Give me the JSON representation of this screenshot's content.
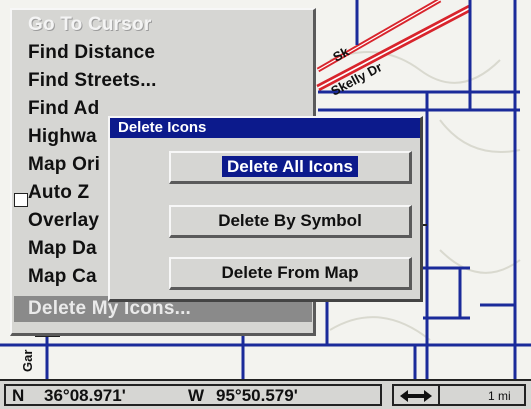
{
  "menu": {
    "items": [
      {
        "label": "Go To Cursor",
        "state": "disabled"
      },
      {
        "label": "Find Distance",
        "state": "normal"
      },
      {
        "label": "Find Streets...",
        "state": "normal"
      },
      {
        "label": "Find Ad",
        "state": "normal"
      },
      {
        "label": "Highwa",
        "state": "normal"
      },
      {
        "label": "Map Ori",
        "state": "normal"
      },
      {
        "label": "Auto Z",
        "state": "checkbox"
      },
      {
        "label": "Overlay",
        "state": "normal"
      },
      {
        "label": "Map Da",
        "state": "normal"
      },
      {
        "label": "Map Ca",
        "state": "normal"
      },
      {
        "label": "Delete My Icons...",
        "state": "selected"
      }
    ]
  },
  "dialog": {
    "title": "Delete Icons",
    "buttons": [
      {
        "label": "Delete All Icons",
        "focused": true
      },
      {
        "label": "Delete By Symbol",
        "focused": false
      },
      {
        "label": "Delete From Map",
        "focused": false
      }
    ]
  },
  "map": {
    "street_label_1": "Sk",
    "street_label_2": "Skelly Dr",
    "street_label_3": "Gar"
  },
  "status": {
    "lat_hemisphere": "N",
    "latitude": "36°08.971'",
    "lon_hemisphere": "W",
    "longitude": "95°50.579'",
    "arrow_icon": "double-arrow-icon",
    "scale": "1 mi"
  },
  "colors": {
    "highway_red": "#d8242c",
    "road_blue": "#1a2a9a",
    "dialog_title_bg": "#0c1a8c",
    "panel_gray": "#d6d6d3"
  }
}
